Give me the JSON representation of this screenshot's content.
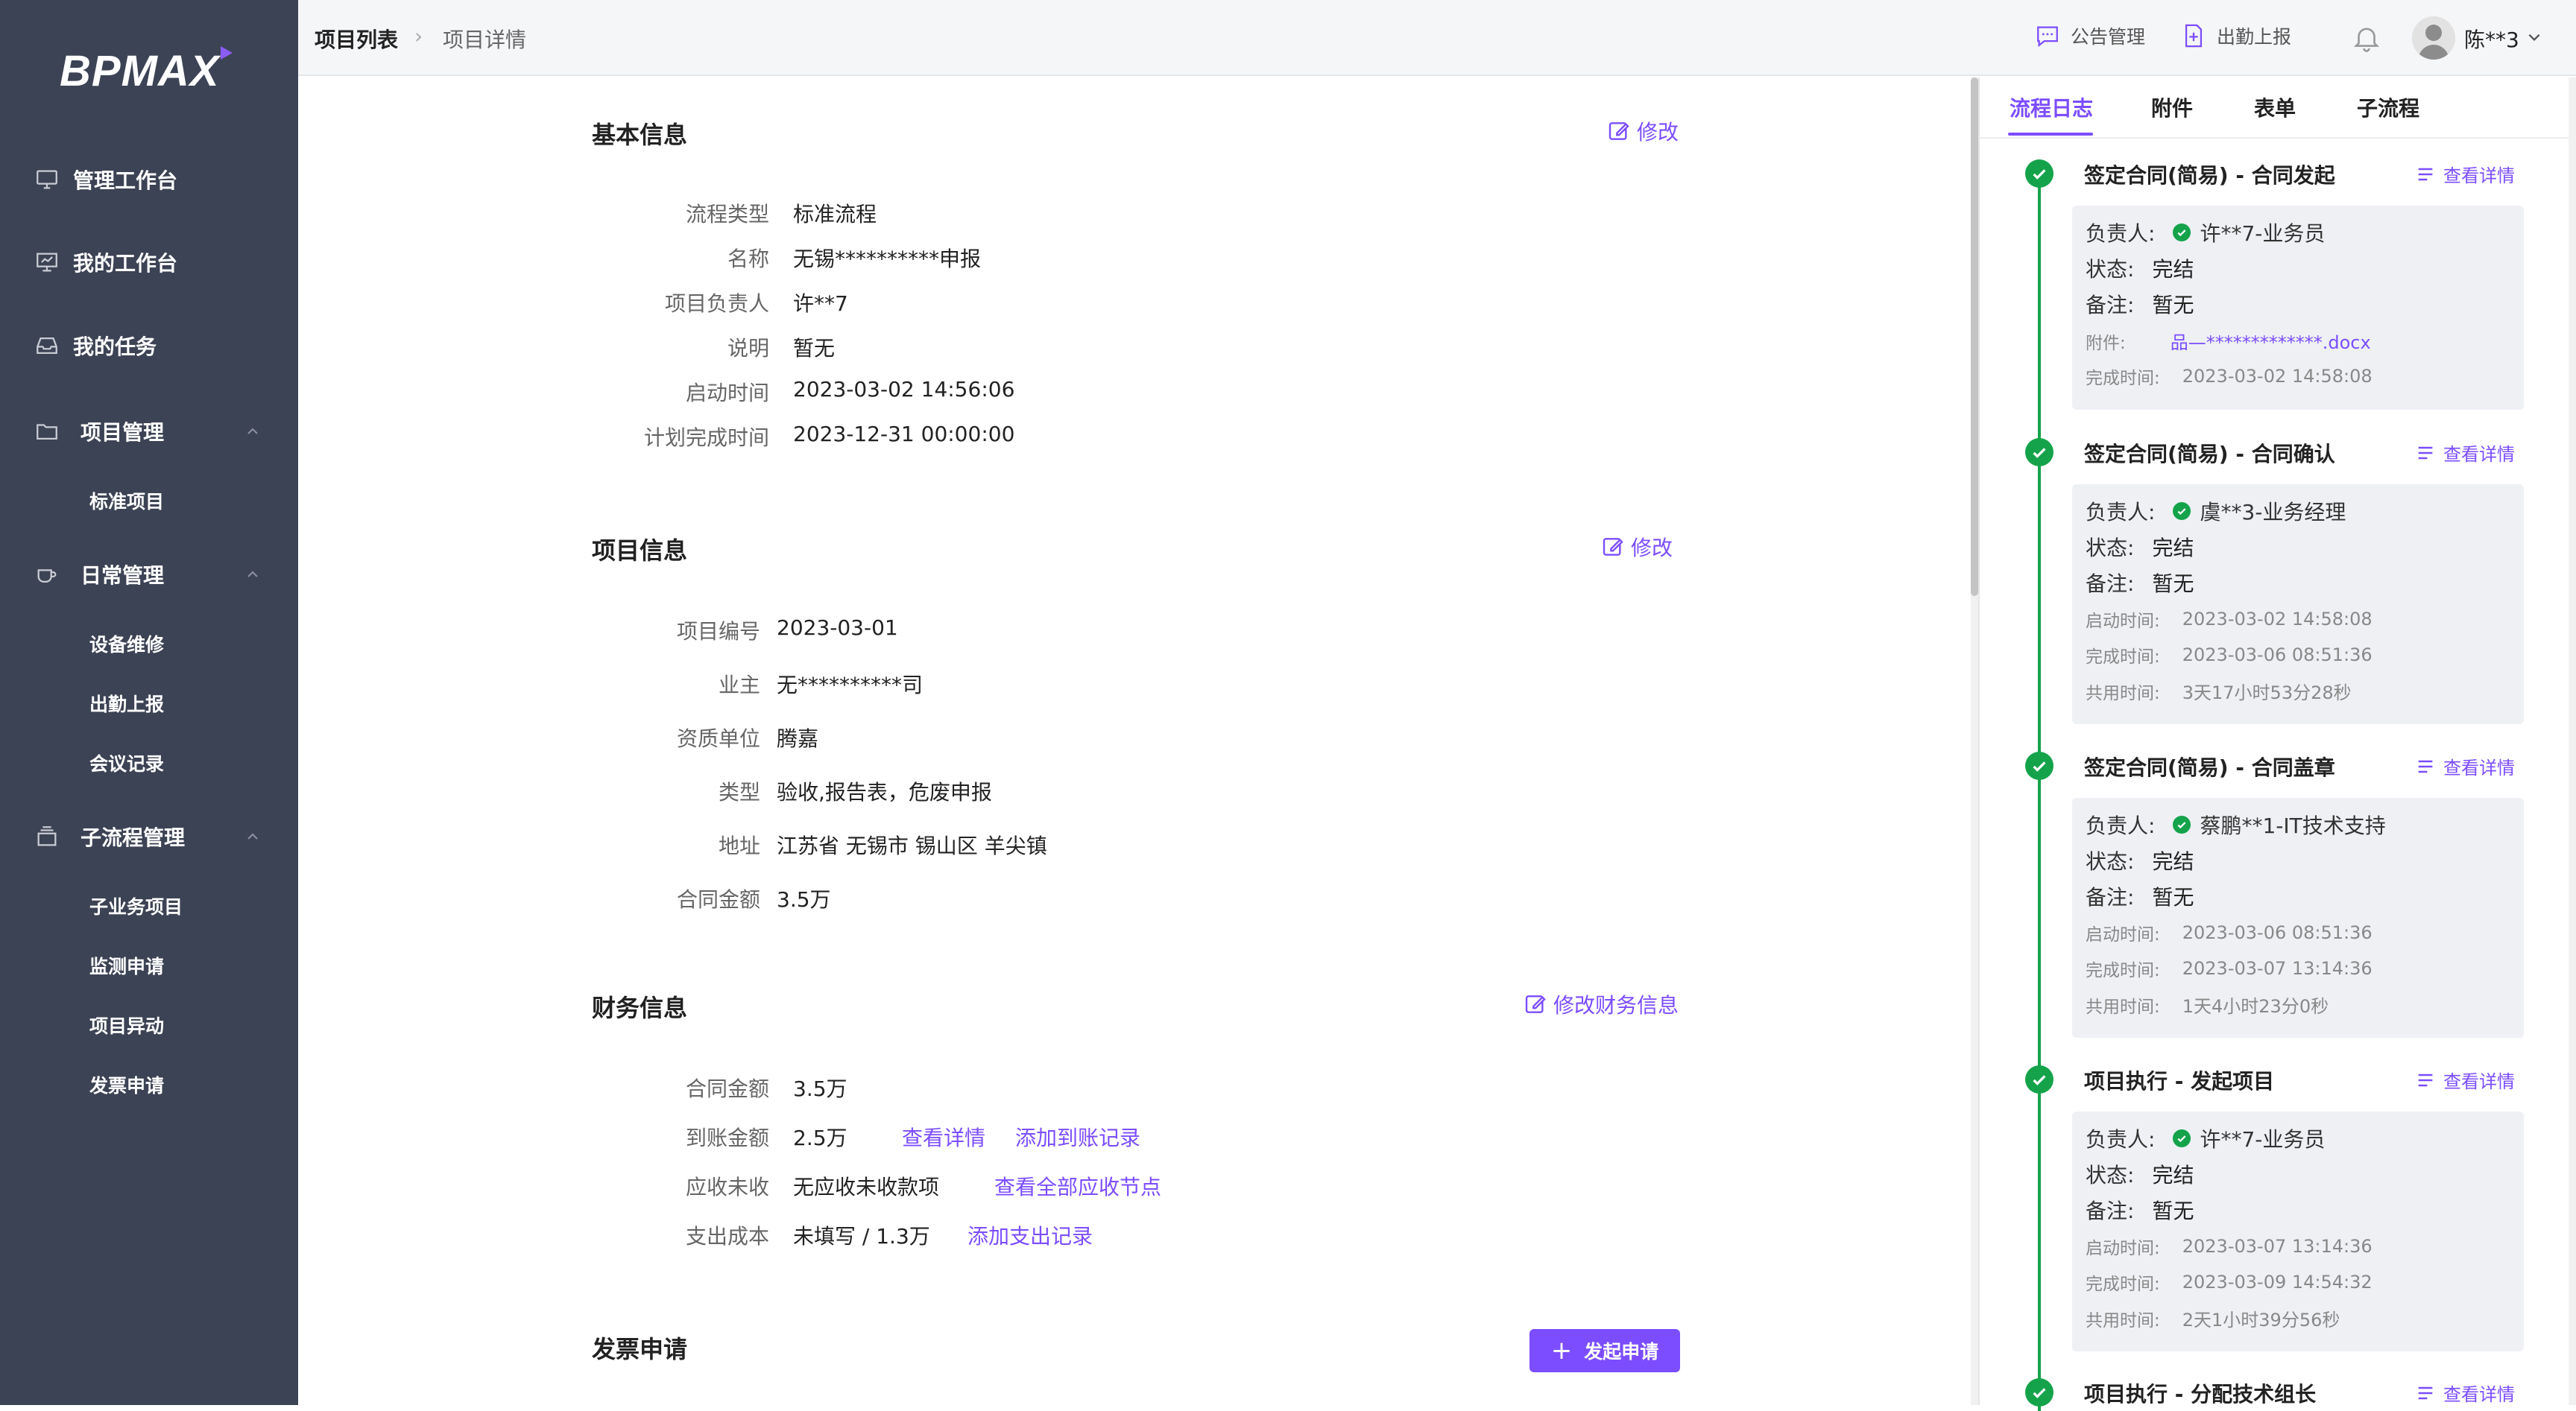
{
  "brand": {
    "logo_text": "BPMAX",
    "accent": "#7c4dff"
  },
  "sidebar": {
    "items": [
      {
        "label": "管理工作台",
        "icon": "monitor-icon"
      },
      {
        "label": "我的工作台",
        "icon": "board-icon"
      },
      {
        "label": "我的任务",
        "icon": "inbox-icon"
      },
      {
        "label": "项目管理",
        "icon": "folder-icon",
        "expanded": true,
        "children": [
          "标准项目"
        ]
      },
      {
        "label": "日常管理",
        "icon": "cup-icon",
        "expanded": true,
        "children": [
          "设备维修",
          "出勤上报",
          "会议记录"
        ]
      },
      {
        "label": "子流程管理",
        "icon": "box-icon",
        "expanded": true,
        "children": [
          "子业务项目",
          "监测申请",
          "项目异动",
          "发票申请"
        ]
      }
    ]
  },
  "header": {
    "breadcrumb": [
      "项目列表",
      "项目详情"
    ],
    "announcement": "公告管理",
    "attendance": "出勤上报",
    "username": "陈**3"
  },
  "basic_info": {
    "title": "基本信息",
    "edit": "修改",
    "fields": [
      {
        "key": "流程类型",
        "value": "标准流程"
      },
      {
        "key": "名称",
        "value": "无锡**********申报"
      },
      {
        "key": "项目负责人",
        "value": "许**7"
      },
      {
        "key": "说明",
        "value": "暂无"
      },
      {
        "key": "启动时间",
        "value": "2023-03-02 14:56:06"
      },
      {
        "key": "计划完成时间",
        "value": "2023-12-31 00:00:00"
      }
    ]
  },
  "project_info": {
    "title": "项目信息",
    "edit": "修改",
    "fields": [
      {
        "key": "项目编号",
        "value": "2023-03-01"
      },
      {
        "key": "业主",
        "value": "无**********司"
      },
      {
        "key": "资质单位",
        "value": "腾嘉"
      },
      {
        "key": "类型",
        "value": "验收,报告表，危废申报"
      },
      {
        "key": "地址",
        "value": "江苏省 无锡市 锡山区 羊尖镇"
      },
      {
        "key": "合同金额",
        "value": "3.5万"
      }
    ]
  },
  "finance_info": {
    "title": "财务信息",
    "edit": "修改财务信息",
    "fields": [
      {
        "key": "合同金额",
        "value": "3.5万"
      },
      {
        "key": "到账金额",
        "value": "2.5万",
        "links": [
          "查看详情",
          "添加到账记录"
        ]
      },
      {
        "key": "应收未收",
        "value": "无应收未收款项",
        "links": [
          "查看全部应收节点"
        ]
      },
      {
        "key": "支出成本",
        "value": "未填写 / 1.3万",
        "links": [
          "添加支出记录"
        ]
      }
    ]
  },
  "invoice": {
    "title": "发票申请",
    "button": "发起申请"
  },
  "right_panel": {
    "tabs": [
      "流程日志",
      "附件",
      "表单",
      "子流程"
    ],
    "active_tab": "流程日志",
    "detail_link": "查看详情",
    "labels": {
      "owner": "负责人:",
      "status": "状态:",
      "note": "备注:",
      "attachment": "附件:",
      "start": "启动时间:",
      "finish": "完成时间:",
      "duration": "共用时间:"
    },
    "logs": [
      {
        "title": "签定合同(简易) - 合同发起",
        "owner": "许**7-业务员",
        "status": "完结",
        "note": "暂无",
        "attachment": "品—*************.docx",
        "finish": "2023-03-02 14:58:08"
      },
      {
        "title": "签定合同(简易) - 合同确认",
        "owner": "虞**3-业务经理",
        "status": "完结",
        "note": "暂无",
        "start": "2023-03-02 14:58:08",
        "finish": "2023-03-06 08:51:36",
        "duration": "3天17小时53分28秒"
      },
      {
        "title": "签定合同(简易) - 合同盖章",
        "owner": "蔡鹏**1-IT技术支持",
        "status": "完结",
        "note": "暂无",
        "start": "2023-03-06 08:51:36",
        "finish": "2023-03-07 13:14:36",
        "duration": "1天4小时23分0秒"
      },
      {
        "title": "项目执行 - 发起项目",
        "owner": "许**7-业务员",
        "status": "完结",
        "note": "暂无",
        "start": "2023-03-07 13:14:36",
        "finish": "2023-03-09 14:54:32",
        "duration": "2天1小时39分56秒"
      },
      {
        "title": "项目执行 - 分配技术组长"
      }
    ]
  }
}
